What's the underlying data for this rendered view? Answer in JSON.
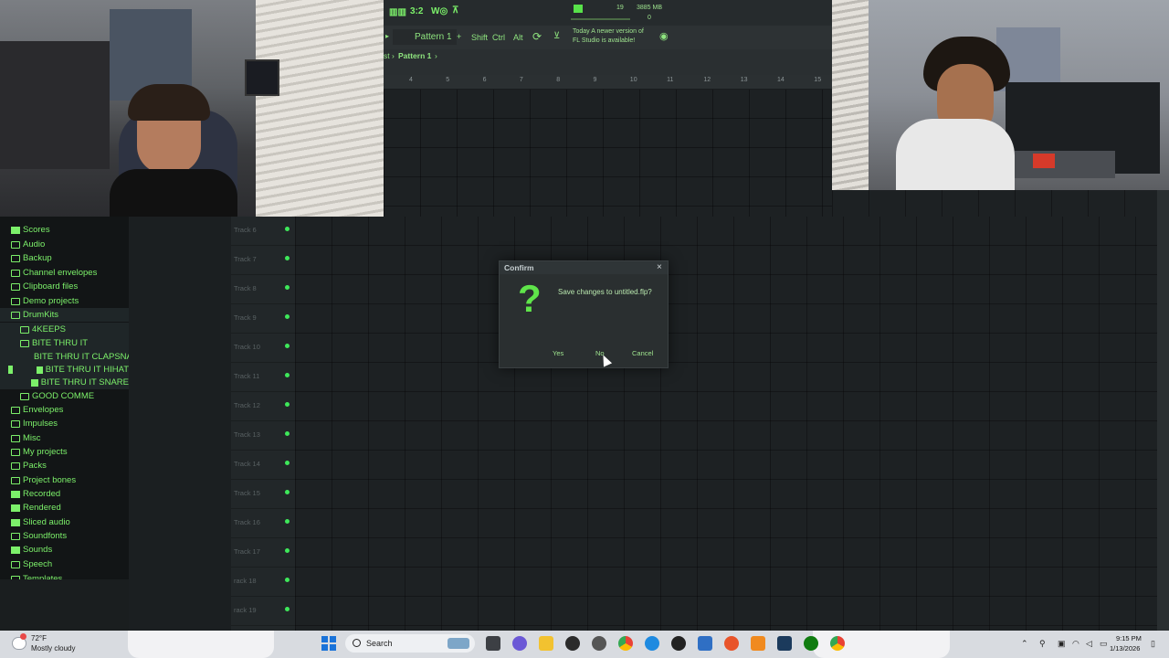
{
  "fl_studio": {
    "toolbar": {
      "pattern_label": "Pattern 1",
      "modifier_shift": "Shift",
      "modifier_ctrl": "Ctrl",
      "modifier_alt": "Alt",
      "meter_value": "19",
      "memory": "3885 MB",
      "cpu": "0",
      "news_line1": "Today  A newer version of",
      "news_line2": "FL Studio is available!"
    },
    "breadcrumb": {
      "prefix": "st",
      "separator": "›",
      "current": "Pattern 1",
      "arrow": "›"
    },
    "ruler": [
      "4",
      "5",
      "6",
      "7",
      "8",
      "9",
      "10",
      "11",
      "12",
      "13",
      "14",
      "15"
    ],
    "browser": {
      "items": [
        {
          "label": "Scores",
          "icon": "note-icon"
        },
        {
          "label": "Audio",
          "icon": "folder-icon"
        },
        {
          "label": "Backup",
          "icon": "folder-icon"
        },
        {
          "label": "Channel envelopes",
          "icon": "folder-icon"
        },
        {
          "label": "Clipboard files",
          "icon": "folder-icon"
        },
        {
          "label": "Demo projects",
          "icon": "folder-icon"
        },
        {
          "label": "DrumKits",
          "icon": "folder-icon"
        },
        {
          "label": "4KEEPS",
          "icon": "folder-icon"
        },
        {
          "label": "BITE THRU IT",
          "icon": "folder-icon"
        },
        {
          "label": "BITE THRU IT CLAPSNARE",
          "icon": "pattern-icon"
        },
        {
          "label": "BITE THRU IT HIHAT",
          "icon": "pattern-icon"
        },
        {
          "label": "BITE THRU IT SNARE",
          "icon": "pattern-icon"
        },
        {
          "label": "GOOD COMME",
          "icon": "folder-icon"
        },
        {
          "label": "Envelopes",
          "icon": "folder-icon"
        },
        {
          "label": "Impulses",
          "icon": "folder-icon"
        },
        {
          "label": "Misc",
          "icon": "folder-icon"
        },
        {
          "label": "My projects",
          "icon": "folder-icon"
        },
        {
          "label": "Packs",
          "icon": "folder-icon"
        },
        {
          "label": "Project bones",
          "icon": "folder-icon"
        },
        {
          "label": "Recorded",
          "icon": "plus-icon"
        },
        {
          "label": "Rendered",
          "icon": "plus-icon"
        },
        {
          "label": "Sliced audio",
          "icon": "plus-icon"
        },
        {
          "label": "Soundfonts",
          "icon": "folder-icon"
        },
        {
          "label": "Sounds",
          "icon": "cloud-icon"
        },
        {
          "label": "Speech",
          "icon": "folder-icon"
        },
        {
          "label": "Templates",
          "icon": "folder-icon"
        }
      ]
    },
    "tracks": [
      "Track 6",
      "Track 7",
      "Track 8",
      "Track 9",
      "Track 10",
      "Track 11",
      "Track 12",
      "Track 13",
      "Track 14",
      "Track 15",
      "Track 16",
      "Track 17",
      "rack 18",
      "rack 19"
    ],
    "dialog": {
      "title": "Confirm",
      "close": "×",
      "question_mark": "?",
      "message": "Save changes to untitled.flp?",
      "yes": "Yes",
      "no": "No",
      "cancel": "Cancel"
    }
  },
  "taskbar": {
    "temperature": "72°F",
    "condition": "Mostly cloudy",
    "search_label": "Search",
    "time": "9:15 PM",
    "date": "1/13/2026"
  },
  "colors": {
    "accent_green": "#7cf06a",
    "led_green": "#3ee85a",
    "panel_dark": "#121516",
    "grid_bg": "#1d2123"
  }
}
